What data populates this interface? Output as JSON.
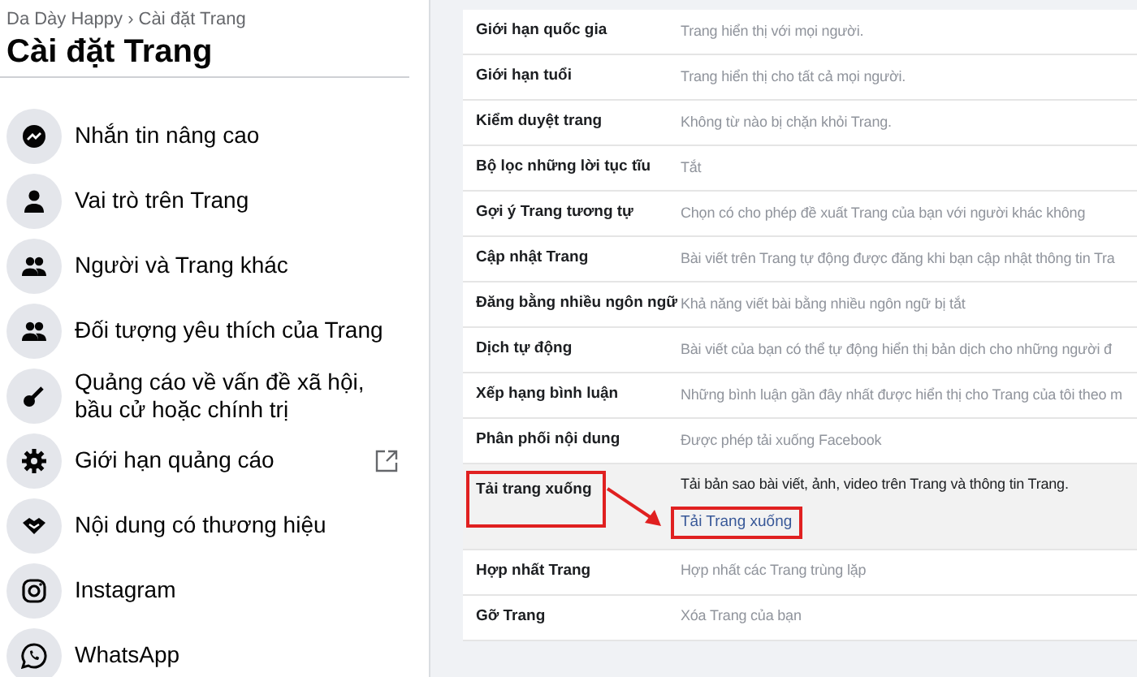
{
  "breadcrumb": "Da Dày Happy › Cài đặt Trang",
  "title": "Cài đặt Trang",
  "sidebar": {
    "items": [
      {
        "label": "Nhắn tin nâng cao",
        "external": false
      },
      {
        "label": "Vai trò trên Trang",
        "external": false
      },
      {
        "label": "Người và Trang khác",
        "external": false
      },
      {
        "label": "Đối tượng yêu thích của Trang",
        "external": false
      },
      {
        "label": "Quảng cáo về vấn đề xã hội, bầu cử hoặc chính trị",
        "external": false
      },
      {
        "label": "Giới hạn quảng cáo",
        "external": true
      },
      {
        "label": "Nội dung có thương hiệu",
        "external": false
      },
      {
        "label": "Instagram",
        "external": false
      },
      {
        "label": "WhatsApp",
        "external": false
      }
    ]
  },
  "settings": {
    "rows": [
      {
        "label": "Giới hạn quốc gia",
        "value": "Trang hiển thị với mọi người.",
        "expanded": false
      },
      {
        "label": "Giới hạn tuổi",
        "value": "Trang hiển thị cho tất cả mọi người.",
        "expanded": false
      },
      {
        "label": "Kiểm duyệt trang",
        "value": "Không từ nào bị chặn khỏi Trang.",
        "expanded": false
      },
      {
        "label": "Bộ lọc những lời tục tĩu",
        "value": "Tắt",
        "expanded": false
      },
      {
        "label": "Gợi ý Trang tương tự",
        "value": "Chọn có cho phép đề xuất Trang của bạn với người khác không",
        "expanded": false
      },
      {
        "label": "Cập nhật Trang",
        "value": "Bài viết trên Trang tự động được đăng khi bạn cập nhật thông tin Tra",
        "expanded": false
      },
      {
        "label": "Đăng bằng nhiều ngôn ngữ",
        "value": "Khả năng viết bài bằng nhiều ngôn ngữ bị tắt",
        "expanded": false
      },
      {
        "label": "Dịch tự động",
        "value": "Bài viết của bạn có thể tự động hiển thị bản dịch cho những người đ",
        "expanded": false
      },
      {
        "label": "Xếp hạng bình luận",
        "value": "Những bình luận gần đây nhất được hiển thị cho Trang của tôi theo m",
        "expanded": false
      },
      {
        "label": "Phân phối nội dung",
        "value": "Được phép tải xuống Facebook",
        "expanded": false
      },
      {
        "label": "Tải trang xuống",
        "value": "Tải bản sao bài viết, ảnh, video trên Trang và thông tin Trang.",
        "expanded": true,
        "link": "Tải Trang xuống",
        "highlighted": true
      },
      {
        "label": "Hợp nhất Trang",
        "value": "Hợp nhất các Trang trùng lặp",
        "expanded": false
      },
      {
        "label": "Gỡ Trang",
        "value": "Xóa Trang của bạn",
        "expanded": false
      }
    ]
  }
}
